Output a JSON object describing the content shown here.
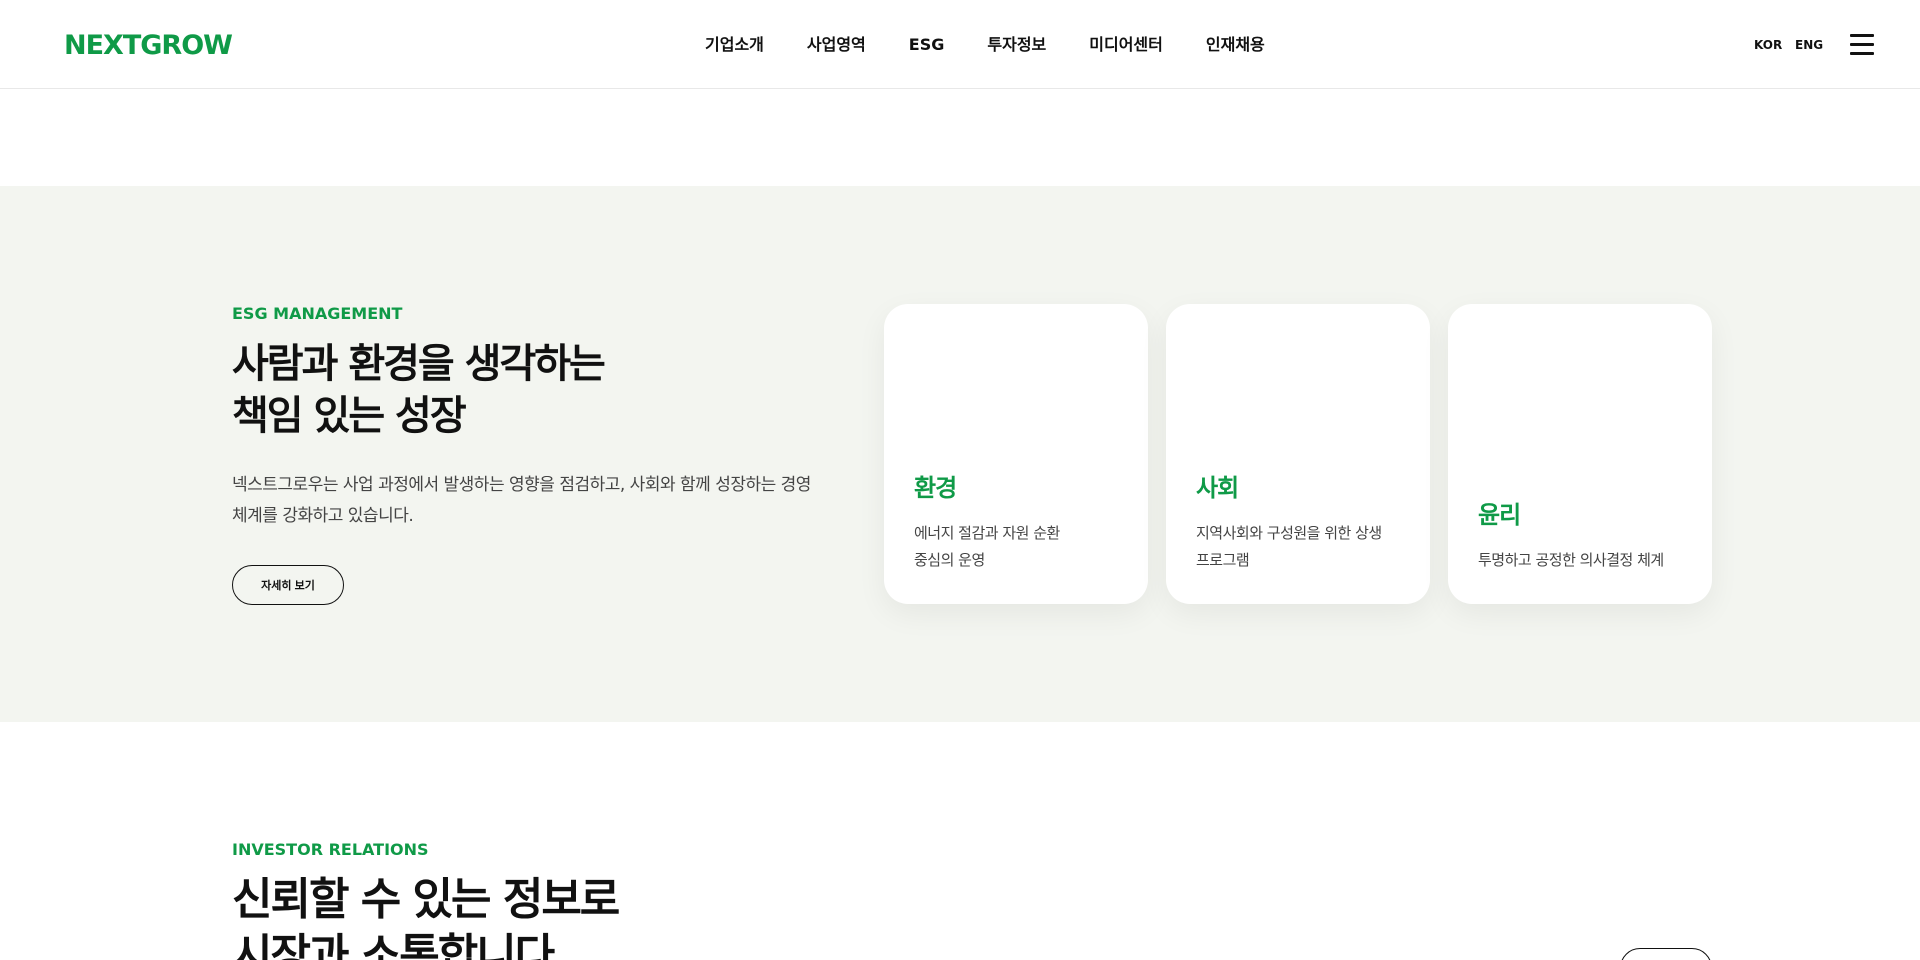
{
  "header": {
    "logo": "NEXTGROW",
    "nav": [
      "기업소개",
      "사업영역",
      "ESG",
      "투자정보",
      "미디어센터",
      "인재채용"
    ],
    "lang_kor": "KOR",
    "lang_eng": "ENG",
    "menu_icon": "hamburger-icon"
  },
  "esg": {
    "eyebrow": "ESG MANAGEMENT",
    "title_line1": "사람과 환경을 생각하는",
    "title_line2": "책임 있는 성장",
    "description_line1": "넥스트그로우는 사업 과정에서 발생하는 영향을 점검하고, 사회와 함께 성장하는 경영",
    "description_line2": "체계를 강화하고 있습니다.",
    "more_label": "자세히 보기",
    "cards": [
      {
        "title": "환경",
        "desc_line1": "에너지 절감과 자원 순환",
        "desc_line2": "중심의 운영"
      },
      {
        "title": "사회",
        "desc_line1": "지역사회와 구성원을 위한 상생",
        "desc_line2": "프로그램"
      },
      {
        "title": "윤리",
        "desc_line1": "투명하고 공정한 의사결정 체계"
      }
    ]
  },
  "ir": {
    "eyebrow": "INVESTOR RELATIONS",
    "title_line1": "신뢰할 수 있는 정보로",
    "title_line2": "시장과 소통합니다"
  },
  "colors": {
    "brand_green": "#0f9a47",
    "section_bg": "#f3f5f0",
    "text": "#111111"
  }
}
